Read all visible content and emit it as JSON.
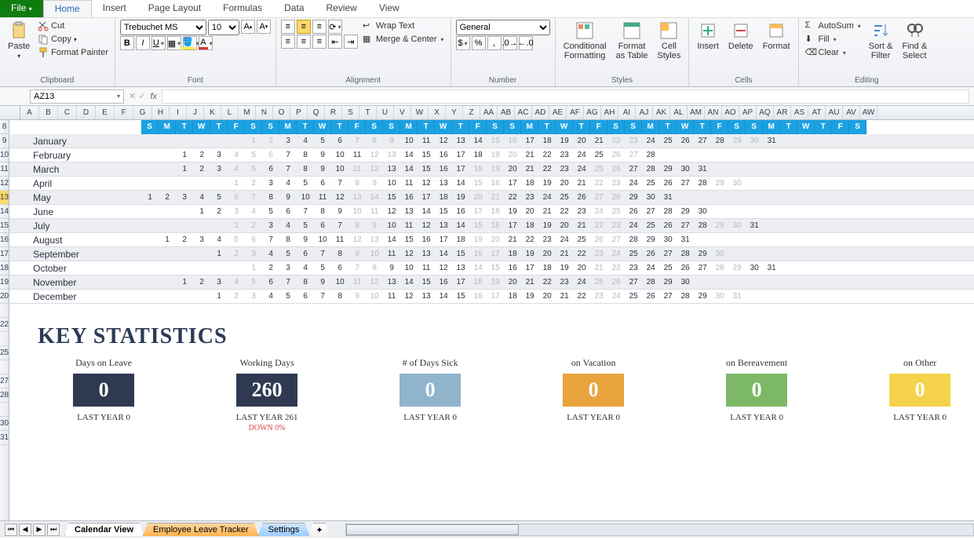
{
  "tabs": {
    "file": "File",
    "items": [
      "Home",
      "Insert",
      "Page Layout",
      "Formulas",
      "Data",
      "Review",
      "View"
    ],
    "active": "Home"
  },
  "clipboard": {
    "paste": "Paste",
    "cut": "Cut",
    "copy": "Copy",
    "painter": "Format Painter",
    "label": "Clipboard"
  },
  "font": {
    "name": "Trebuchet MS",
    "size": "10",
    "label": "Font"
  },
  "alignment": {
    "wrap": "Wrap Text",
    "merge": "Merge & Center",
    "label": "Alignment"
  },
  "number": {
    "format": "General",
    "label": "Number"
  },
  "styles": {
    "cond": "Conditional\nFormatting",
    "table": "Format\nas Table",
    "cell": "Cell\nStyles",
    "label": "Styles"
  },
  "cells_grp": {
    "insert": "Insert",
    "delete": "Delete",
    "format": "Format",
    "label": "Cells"
  },
  "editing": {
    "autosum": "AutoSum",
    "fill": "Fill",
    "clear": "Clear",
    "sort": "Sort &\nFilter",
    "find": "Find &\nSelect",
    "label": "Editing"
  },
  "name_box": "AZ13",
  "col_letters": [
    "A",
    "B",
    "C",
    "D",
    "E",
    "F",
    "G",
    "H",
    "I",
    "J",
    "K",
    "L",
    "M",
    "N",
    "O",
    "P",
    "Q",
    "R",
    "S",
    "T",
    "U",
    "V",
    "W",
    "X",
    "Y",
    "Z",
    "AA",
    "AB",
    "AC",
    "AD",
    "AE",
    "AF",
    "AG",
    "AH",
    "AI",
    "AJ",
    "AK",
    "AL",
    "AM",
    "AN",
    "AO",
    "AP",
    "AQ",
    "AR",
    "AS",
    "AT",
    "AU",
    "AV",
    "AW"
  ],
  "row_nums": [
    "8",
    "9",
    "10",
    "11",
    "12",
    "13",
    "14",
    "15",
    "16",
    "17",
    "18",
    "19",
    "20",
    "",
    "22",
    "",
    "25",
    "",
    "27",
    "28",
    "",
    "30",
    "31"
  ],
  "selected_row": "13",
  "day_headers": [
    "S",
    "M",
    "T",
    "W",
    "T",
    "F",
    "S",
    "S",
    "M",
    "T",
    "W",
    "T",
    "F",
    "S",
    "S",
    "M",
    "T",
    "W",
    "T",
    "F",
    "S",
    "S",
    "M",
    "T",
    "W",
    "T",
    "F",
    "S",
    "S",
    "M",
    "T",
    "W",
    "T",
    "F",
    "S",
    "S",
    "M",
    "T",
    "W",
    "T",
    "F",
    "S"
  ],
  "months": [
    {
      "name": "January",
      "offset": 7,
      "len": 31,
      "gray": [
        1,
        2,
        7,
        8,
        9,
        15,
        16,
        22,
        23,
        29,
        30
      ]
    },
    {
      "name": "February",
      "offset": 3,
      "len": 28,
      "gray": [
        4,
        5,
        6,
        12,
        13,
        19,
        20,
        26,
        27
      ]
    },
    {
      "name": "March",
      "offset": 3,
      "len": 31,
      "gray": [
        4,
        5,
        11,
        12,
        18,
        19,
        25,
        26
      ]
    },
    {
      "name": "April",
      "offset": 6,
      "len": 30,
      "gray": [
        1,
        2,
        8,
        9,
        15,
        16,
        22,
        23,
        29,
        30
      ]
    },
    {
      "name": "May",
      "offset": 1,
      "len": 31,
      "gray": [
        6,
        7,
        13,
        14,
        20,
        21,
        27,
        28
      ]
    },
    {
      "name": "June",
      "offset": 4,
      "len": 30,
      "gray": [
        3,
        4,
        10,
        11,
        17,
        18,
        24,
        25
      ]
    },
    {
      "name": "July",
      "offset": 6,
      "len": 31,
      "gray": [
        1,
        2,
        8,
        9,
        15,
        16,
        22,
        23,
        29,
        30
      ]
    },
    {
      "name": "August",
      "offset": 2,
      "len": 31,
      "gray": [
        5,
        6,
        12,
        13,
        19,
        20,
        26,
        27
      ]
    },
    {
      "name": "September",
      "offset": 5,
      "len": 30,
      "gray": [
        2,
        3,
        9,
        10,
        16,
        17,
        23,
        24,
        30
      ]
    },
    {
      "name": "October",
      "offset": 7,
      "len": 31,
      "gray": [
        1,
        7,
        8,
        14,
        15,
        21,
        22,
        28,
        29
      ]
    },
    {
      "name": "November",
      "offset": 3,
      "len": 30,
      "gray": [
        4,
        5,
        11,
        12,
        18,
        19,
        25,
        26
      ]
    },
    {
      "name": "December",
      "offset": 5,
      "len": 31,
      "gray": [
        2,
        3,
        9,
        10,
        16,
        17,
        23,
        24,
        30,
        31
      ]
    }
  ],
  "stats_title": "KEY STATISTICS",
  "stats": [
    {
      "title": "Days on Leave",
      "value": "0",
      "color": "#2f3a52",
      "last": "LAST YEAR  0"
    },
    {
      "title": "Working Days",
      "value": "260",
      "color": "#2f3a52",
      "last": "LAST YEAR 261",
      "extra": "DOWN 0%"
    },
    {
      "title": "# of Days Sick",
      "value": "0",
      "color": "#8fb4cc",
      "last": "LAST YEAR 0"
    },
    {
      "title": "on Vacation",
      "value": "0",
      "color": "#e8a33d",
      "last": "LAST YEAR 0"
    },
    {
      "title": "on Bereavement",
      "value": "0",
      "color": "#7db867",
      "last": "LAST YEAR 0"
    },
    {
      "title": "on Other",
      "value": "0",
      "color": "#f4d24a",
      "last": "LAST YEAR 0"
    }
  ],
  "sheet_tabs": [
    {
      "label": "Calendar View",
      "cls": "active"
    },
    {
      "label": "Employee Leave Tracker",
      "cls": "orange"
    },
    {
      "label": "Settings",
      "cls": "blue"
    }
  ]
}
